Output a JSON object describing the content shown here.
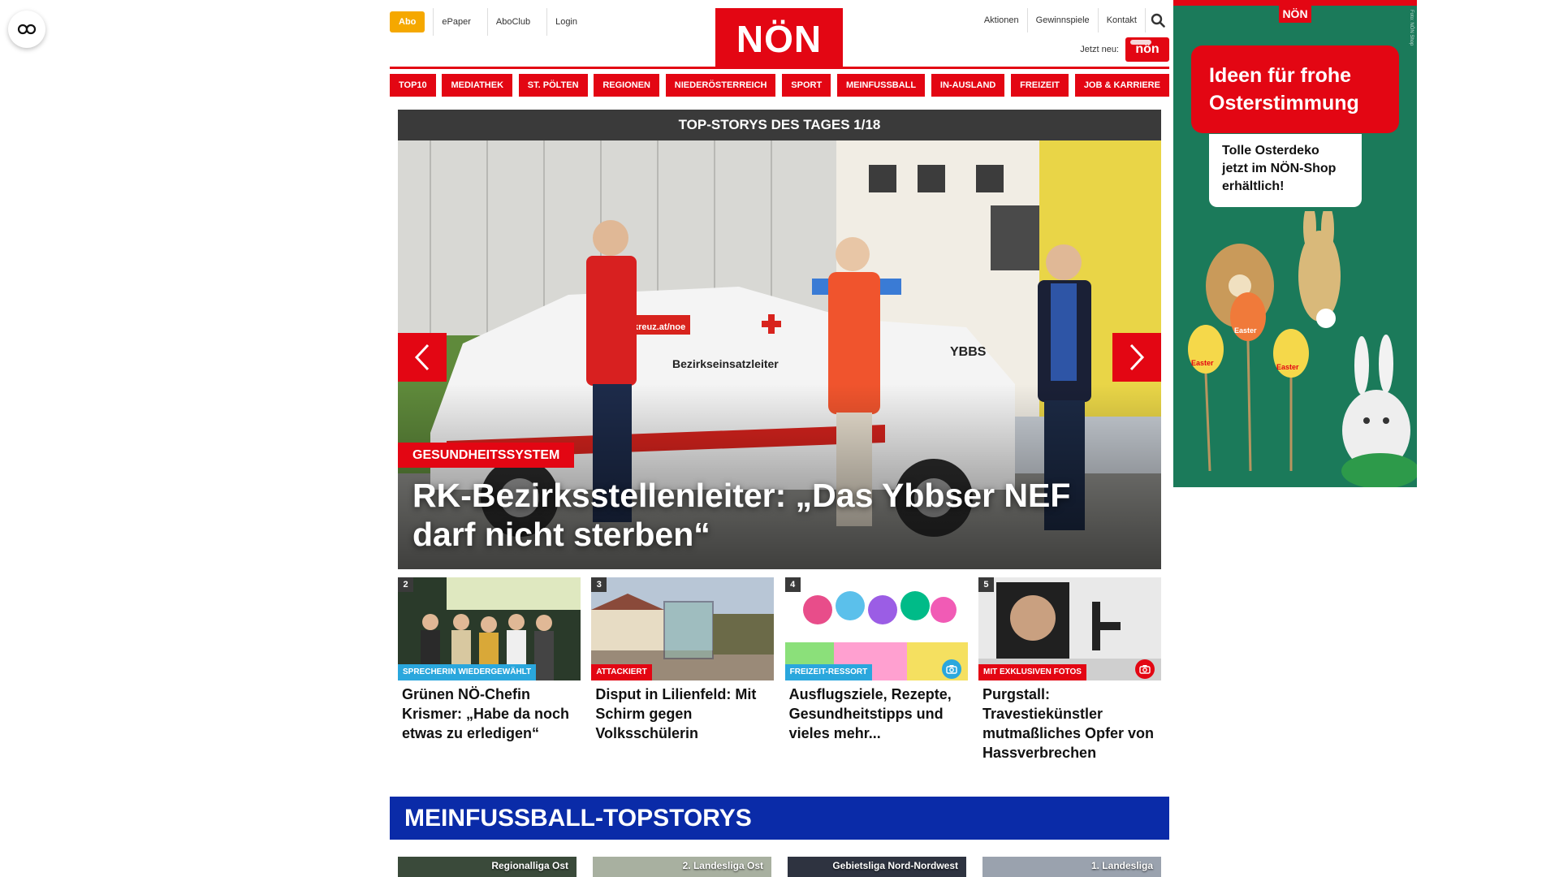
{
  "header": {
    "abo_label": "Abo",
    "links_left": [
      "ePaper",
      "AboClub",
      "Login"
    ],
    "logo_text": "NÖN",
    "links_right": [
      "Aktionen",
      "Gewinnspiele",
      "Kontakt"
    ],
    "jetzt_label": "Jetzt neu:",
    "jetzt_logo_text": "nön"
  },
  "nav": {
    "items": [
      "TOP10",
      "MEDIATHEK",
      "ST. PÖLTEN",
      "REGIONEN",
      "NIEDERÖSTERREICH",
      "SPORT",
      "MEINFUSSBALL",
      "IN-AUSLAND",
      "FREIZEIT",
      "JOB & KARRIERE"
    ]
  },
  "hero": {
    "header": "TOP-STORYS DES TAGES 1/18",
    "category": "GESUNDHEITSSYSTEM",
    "title": "RK-Bezirksstellenleiter: „Das Ybbser NEF darf nicht sterben“",
    "car_text": "Bezirkseinsatzleiter",
    "car_plate_text": "YBBS",
    "car_url_text": "kreuz.at/noe"
  },
  "cards": [
    {
      "num": "2",
      "tag": "SPRECHERIN WIEDERGEWÄHLT",
      "tag_color": "#2aa7dd",
      "title": "Grünen NÖ-Chefin Krismer: „Habe da noch etwas zu erledigen“"
    },
    {
      "num": "3",
      "tag": "ATTACKIERT",
      "tag_color": "#e30613",
      "title": "Disput in Lilienfeld: Mit Schirm gegen Volksschülerin"
    },
    {
      "num": "4",
      "tag": "FREIZEIT-RESSORT",
      "tag_color": "#2aa7dd",
      "title": "Ausflugsziele, Rezepte, Gesundheitstipps und vieles mehr...",
      "icon": "camera-icon"
    },
    {
      "num": "5",
      "tag": "MIT EXKLUSIVEN FOTOS",
      "tag_color": "#e30613",
      "title": "Purgstall: Travestiekünstler mutmaßliches Opfer von Hassverbrechen",
      "icon": "camera-icon"
    }
  ],
  "football": {
    "title": "MEINFUSSBALL-TOPSTORYS",
    "cards": [
      "Regionalliga Ost",
      "2. Landesliga Ost",
      "Gebietsliga Nord-Nordwest",
      "1. Landesliga"
    ]
  },
  "ad": {
    "logo": "NÖN",
    "headline": "Ideen für frohe Osterstimmung",
    "sub": "Tolle Osterdeko jetzt im NÖN-Shop erhältlich!",
    "credit": "Foto: NÖN Shop",
    "egg_text": "Easter"
  },
  "colors": {
    "brand_red": "#e30613",
    "abo_orange": "#f5a800",
    "football_blue": "#0a2ba8",
    "tag_blue": "#2aa7dd"
  }
}
